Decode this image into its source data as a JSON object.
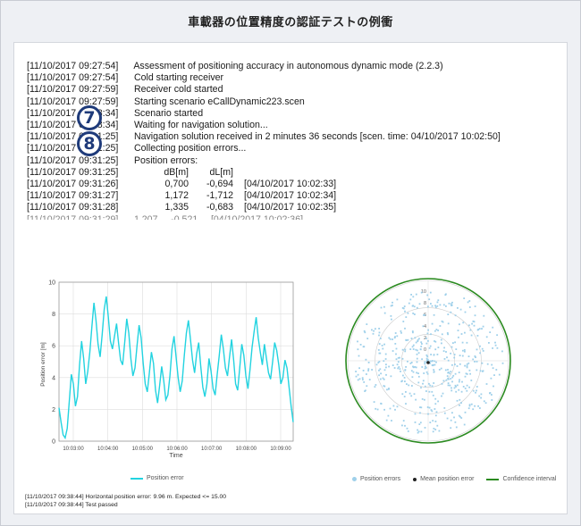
{
  "caption": "車載器の位置精度の認証テストの例衝",
  "log": {
    "lines": [
      {
        "ts": "[11/10/2017 09:27:54]",
        "msg": "Assessment of positioning accuracy in autonomous dynamic mode (2.2.3)"
      },
      {
        "ts": "[11/10/2017 09:27:54]",
        "msg": "Cold starting receiver"
      },
      {
        "ts": "[11/10/2017 09:27:59]",
        "msg": "Receiver cold started"
      },
      {
        "ts": "[11/10/2017 09:27:59]",
        "msg": "Starting scenario eCallDynamic223.scen"
      },
      {
        "ts": "[11/10/2017 09:28:34]",
        "msg": "Scenario started"
      },
      {
        "ts": "[11/10/2017 09:28:34]",
        "msg": "Waiting for navigation solution..."
      },
      {
        "ts": "[11/10/2017 09:31:25]",
        "msg": "Navigation solution received in 2 minutes 36 seconds [scen. time: 04/10/2017 10:02:50]"
      },
      {
        "ts": "[11/10/2017 09:31:25]",
        "msg": "Collecting position errors..."
      },
      {
        "ts": "[11/10/2017 09:31:25]",
        "msg": "Position errors:"
      }
    ],
    "error_table": {
      "header_ts": "[11/10/2017 09:31:25]",
      "col_db": "dB[m]",
      "col_dl": "dL[m]",
      "rows": [
        {
          "ts": "[11/10/2017 09:31:26]",
          "db": "0,700",
          "dl": "-0,694",
          "time": "[04/10/2017 10:02:33]"
        },
        {
          "ts": "[11/10/2017 09:31:27]",
          "db": "1,172",
          "dl": "-1,712",
          "time": "[04/10/2017 10:02:34]"
        },
        {
          "ts": "[11/10/2017 09:31:28]",
          "db": "1,335",
          "dl": "-0,683",
          "time": "[04/10/2017 10:02:35]"
        }
      ]
    },
    "badges": [
      "7",
      "8"
    ]
  },
  "chart_data": [
    {
      "type": "line",
      "ylabel": "Position error [m]",
      "xlabel": "Time",
      "ylim": [
        0,
        10
      ],
      "yticks": [
        "0",
        "2",
        "4",
        "6",
        "8",
        "10"
      ],
      "xticks": [
        "10:03:00",
        "10:04:00",
        "10:05:00",
        "10:06:00",
        "10:07:00",
        "10:08:00",
        "10:09:00"
      ],
      "grid": true,
      "series": [
        {
          "name": "Position error",
          "color": "#22d3e0",
          "values": [
            2.1,
            1.2,
            0.4,
            0.2,
            0.8,
            2.5,
            4.2,
            3.6,
            2.2,
            2.8,
            4.8,
            6.3,
            5.2,
            3.6,
            4.4,
            5.6,
            7.2,
            8.7,
            7.6,
            6.1,
            5.3,
            6.7,
            8.3,
            9.1,
            7.8,
            6.3,
            5.8,
            6.6,
            7.4,
            6.2,
            5.1,
            4.8,
            6.2,
            7.7,
            6.8,
            5.2,
            4.1,
            4.6,
            6.0,
            7.3,
            6.5,
            4.9,
            3.6,
            3.1,
            4.3,
            5.6,
            4.9,
            3.2,
            2.4,
            3.5,
            4.7,
            3.8,
            2.6,
            2.9,
            4.1,
            5.8,
            6.6,
            5.3,
            4.0,
            3.1,
            3.8,
            5.4,
            6.8,
            7.6,
            6.4,
            5.1,
            4.3,
            5.5,
            6.2,
            4.7,
            3.4,
            2.8,
            3.6,
            5.2,
            4.4,
            3.3,
            2.9,
            4.2,
            5.4,
            6.7,
            5.8,
            4.6,
            4.1,
            5.3,
            6.4,
            5.1,
            3.6,
            3.2,
            4.6,
            6.1,
            5.4,
            4.1,
            3.3,
            4.5,
            5.9,
            6.9,
            7.8,
            6.5,
            5.6,
            4.8,
            6.1,
            5.2,
            4.3,
            3.9,
            5.0,
            6.2,
            5.7,
            4.8,
            3.6,
            4.0,
            5.1,
            4.6,
            3.4,
            2.2,
            1.2
          ]
        }
      ]
    },
    {
      "type": "scatter",
      "subtype": "polar",
      "rlabels": [
        "10",
        "8",
        "6",
        "4",
        "2",
        "0"
      ],
      "series": [
        {
          "name": "Position errors",
          "color": "#9fd0ea"
        },
        {
          "name": "Mean position error",
          "color": "#222222"
        },
        {
          "name": "Confidence interval",
          "color": "#2a8a1f"
        }
      ]
    }
  ],
  "footer": [
    "[11/10/2017 09:38:44]  Horizontal position error: 9.96 m. Expected <= 15.00",
    "[11/10/2017 09:38:44]  Test passed"
  ]
}
